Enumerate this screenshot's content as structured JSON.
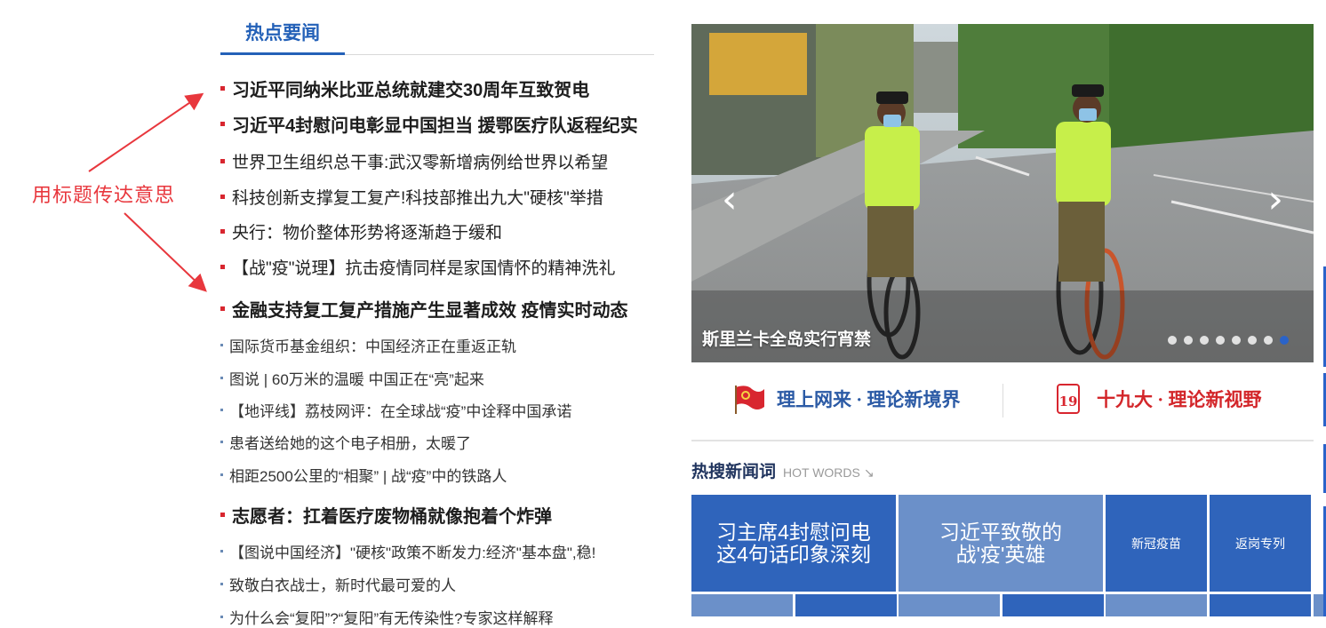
{
  "annotation": "用标题传达意思",
  "section_tab": "热点要闻",
  "headlines": [
    {
      "text": "习近平同纳米比亚总统就建交30周年互致贺电",
      "style": "bold"
    },
    {
      "text": "习近平4封慰问电彰显中国担当  援鄂医疗队返程纪实",
      "style": "bold"
    },
    {
      "text": "世界卫生组织总干事:武汉零新增病例给世界以希望",
      "style": "mid"
    },
    {
      "text": "科技创新支撑复工复产!科技部推出九大\"硬核\"举措",
      "style": "mid"
    },
    {
      "text": "央行：物价整体形势将逐渐趋于缓和",
      "style": "mid"
    },
    {
      "text": "【战\"疫\"说理】抗击疫情同样是家国情怀的精神洗礼",
      "style": "mid"
    },
    {
      "text": "金融支持复工复产措施产生显著成效 疫情实时动态",
      "style": "bold"
    },
    {
      "text": "国际货币基金组织：中国经济正在重返正轨",
      "style": "small"
    },
    {
      "text": "图说 | 60万米的温暖 中国正在“亮”起来",
      "style": "small"
    },
    {
      "text": "【地评线】荔枝网评：在全球战“疫”中诠释中国承诺",
      "style": "small"
    },
    {
      "text": "患者送给她的这个电子相册，太暖了",
      "style": "small"
    },
    {
      "text": "相距2500公里的“相聚” | 战“疫”中的铁路人",
      "style": "small"
    },
    {
      "text": "志愿者：扛着医疗废物桶就像抱着个炸弹",
      "style": "bold"
    },
    {
      "text": "【图说中国经济】\"硬核\"政策不断发力:经济\"基本盘\",稳!",
      "style": "small"
    },
    {
      "text": "致敬白衣战士，新时代最可爱的人",
      "style": "small"
    },
    {
      "text": "为什么会“复阳”?“复阳”有无传染性?专家这样解释",
      "style": "small"
    }
  ],
  "carousel": {
    "caption": "斯里兰卡全岛实行宵禁",
    "prev_glyph": "‹",
    "next_glyph": "›",
    "slide_count": 8,
    "active_index": 8
  },
  "banners": {
    "left": {
      "text": "理上网来 · 理论新境界",
      "color": "#2b5aa5",
      "icon": "party-flag-icon"
    },
    "right": {
      "text": "十九大 · 理论新视野",
      "color": "#d3262a",
      "icon": "nineteenth-congress-icon",
      "icon_text": "19"
    }
  },
  "hot_words": {
    "title": "热搜新闻词",
    "subtitle": "HOT WORDS",
    "arrow": "↘",
    "tiles": [
      {
        "text": "习主席4封慰问电\n这4句话印象深刻",
        "color": "#2f64bb"
      },
      {
        "text": "习近平致敬的\n战'疫'英雄",
        "color": "#6b90c9"
      },
      {
        "text": "新冠疫苗",
        "color": "#2f64bb"
      },
      {
        "text": "返岗专列",
        "color": "#2f64bb"
      }
    ],
    "lower_colors": [
      "#6b90c9",
      "#2f64bb",
      "#6b90c9",
      "#2f64bb",
      "#6b90c9",
      "#2f64bb",
      "#6b90c9"
    ]
  }
}
